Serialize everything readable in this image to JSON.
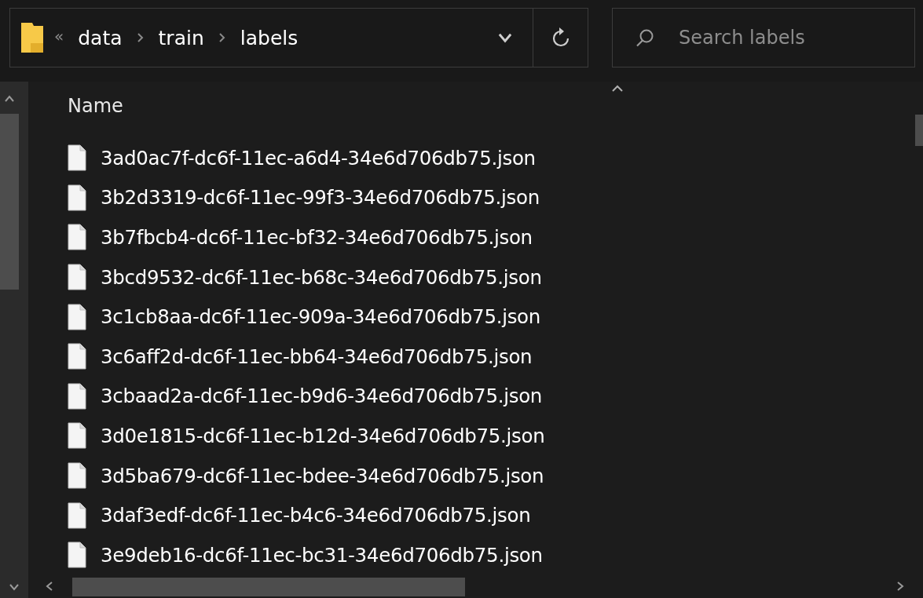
{
  "address_bar": {
    "overflow": "«",
    "breadcrumbs": [
      "data",
      "train",
      "labels"
    ]
  },
  "search": {
    "placeholder": "Search labels"
  },
  "file_list": {
    "columns": [
      {
        "label": "Name",
        "sorted": true
      }
    ],
    "rows": [
      {
        "name": "3ad0ac7f-dc6f-11ec-a6d4-34e6d706db75.json"
      },
      {
        "name": "3b2d3319-dc6f-11ec-99f3-34e6d706db75.json"
      },
      {
        "name": "3b7fbcb4-dc6f-11ec-bf32-34e6d706db75.json"
      },
      {
        "name": "3bcd9532-dc6f-11ec-b68c-34e6d706db75.json"
      },
      {
        "name": "3c1cb8aa-dc6f-11ec-909a-34e6d706db75.json"
      },
      {
        "name": "3c6aff2d-dc6f-11ec-bb64-34e6d706db75.json"
      },
      {
        "name": "3cbaad2a-dc6f-11ec-b9d6-34e6d706db75.json"
      },
      {
        "name": "3d0e1815-dc6f-11ec-b12d-34e6d706db75.json"
      },
      {
        "name": "3d5ba679-dc6f-11ec-bdee-34e6d706db75.json"
      },
      {
        "name": "3daf3edf-dc6f-11ec-b4c6-34e6d706db75.json"
      },
      {
        "name": "3e9deb16-dc6f-11ec-bc31-34e6d706db75.json"
      }
    ]
  }
}
